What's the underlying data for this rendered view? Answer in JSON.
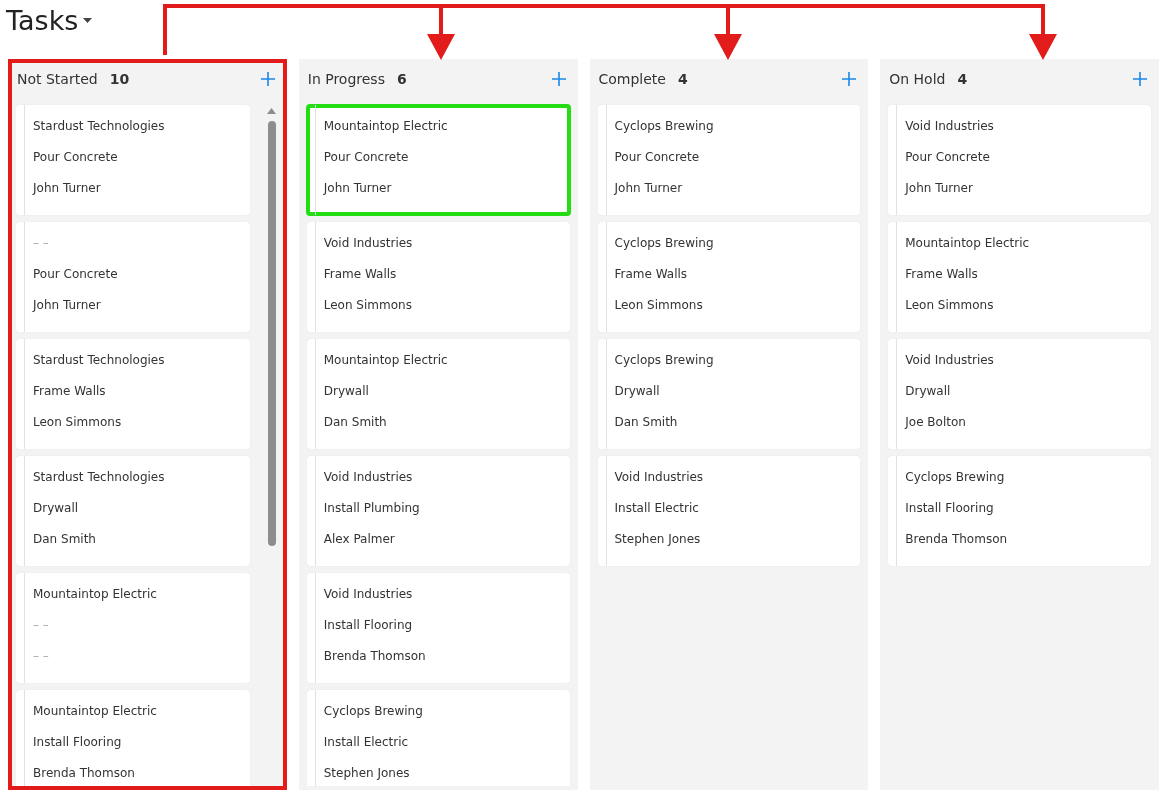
{
  "title": "Tasks",
  "columns": [
    {
      "name": "Not Started",
      "count": "10",
      "highlighted": true,
      "scrollable": true,
      "cards": [
        {
          "highlighted": false,
          "lines": [
            {
              "text": "Stardust Technologies",
              "muted": false
            },
            {
              "text": "Pour Concrete",
              "muted": false
            },
            {
              "text": "John Turner",
              "muted": false
            }
          ]
        },
        {
          "highlighted": false,
          "lines": [
            {
              "text": "– –",
              "muted": true
            },
            {
              "text": "Pour Concrete",
              "muted": false
            },
            {
              "text": "John Turner",
              "muted": false
            }
          ]
        },
        {
          "highlighted": false,
          "lines": [
            {
              "text": "Stardust Technologies",
              "muted": false
            },
            {
              "text": "Frame Walls",
              "muted": false
            },
            {
              "text": "Leon Simmons",
              "muted": false
            }
          ]
        },
        {
          "highlighted": false,
          "lines": [
            {
              "text": "Stardust Technologies",
              "muted": false
            },
            {
              "text": "Drywall",
              "muted": false
            },
            {
              "text": "Dan Smith",
              "muted": false
            }
          ]
        },
        {
          "highlighted": false,
          "lines": [
            {
              "text": "Mountaintop Electric",
              "muted": false
            },
            {
              "text": "– –",
              "muted": true
            },
            {
              "text": "– –",
              "muted": true
            }
          ]
        },
        {
          "highlighted": false,
          "lines": [
            {
              "text": "Mountaintop Electric",
              "muted": false
            },
            {
              "text": "Install Flooring",
              "muted": false
            },
            {
              "text": "Brenda Thomson",
              "muted": false
            }
          ]
        }
      ]
    },
    {
      "name": "In Progress",
      "count": "6",
      "highlighted": false,
      "scrollable": false,
      "cards": [
        {
          "highlighted": true,
          "lines": [
            {
              "text": "Mountaintop Electric",
              "muted": false
            },
            {
              "text": "Pour Concrete",
              "muted": false
            },
            {
              "text": "John Turner",
              "muted": false
            }
          ]
        },
        {
          "highlighted": false,
          "lines": [
            {
              "text": "Void Industries",
              "muted": false
            },
            {
              "text": "Frame Walls",
              "muted": false
            },
            {
              "text": "Leon Simmons",
              "muted": false
            }
          ]
        },
        {
          "highlighted": false,
          "lines": [
            {
              "text": "Mountaintop Electric",
              "muted": false
            },
            {
              "text": "Drywall",
              "muted": false
            },
            {
              "text": "Dan Smith",
              "muted": false
            }
          ]
        },
        {
          "highlighted": false,
          "lines": [
            {
              "text": "Void Industries",
              "muted": false
            },
            {
              "text": "Install Plumbing",
              "muted": false
            },
            {
              "text": "Alex Palmer",
              "muted": false
            }
          ]
        },
        {
          "highlighted": false,
          "lines": [
            {
              "text": "Void Industries",
              "muted": false
            },
            {
              "text": "Install Flooring",
              "muted": false
            },
            {
              "text": "Brenda Thomson",
              "muted": false
            }
          ]
        },
        {
          "highlighted": false,
          "lines": [
            {
              "text": "Cyclops Brewing",
              "muted": false
            },
            {
              "text": "Install Electric",
              "muted": false
            },
            {
              "text": "Stephen Jones",
              "muted": false
            }
          ]
        }
      ]
    },
    {
      "name": "Complete",
      "count": "4",
      "highlighted": false,
      "scrollable": false,
      "cards": [
        {
          "highlighted": false,
          "lines": [
            {
              "text": "Cyclops Brewing",
              "muted": false
            },
            {
              "text": "Pour Concrete",
              "muted": false
            },
            {
              "text": "John Turner",
              "muted": false
            }
          ]
        },
        {
          "highlighted": false,
          "lines": [
            {
              "text": "Cyclops Brewing",
              "muted": false
            },
            {
              "text": "Frame Walls",
              "muted": false
            },
            {
              "text": "Leon Simmons",
              "muted": false
            }
          ]
        },
        {
          "highlighted": false,
          "lines": [
            {
              "text": "Cyclops Brewing",
              "muted": false
            },
            {
              "text": "Drywall",
              "muted": false
            },
            {
              "text": "Dan Smith",
              "muted": false
            }
          ]
        },
        {
          "highlighted": false,
          "lines": [
            {
              "text": "Void Industries",
              "muted": false
            },
            {
              "text": "Install Electric",
              "muted": false
            },
            {
              "text": "Stephen Jones",
              "muted": false
            }
          ]
        }
      ]
    },
    {
      "name": "On Hold",
      "count": "4",
      "highlighted": false,
      "scrollable": false,
      "cards": [
        {
          "highlighted": false,
          "lines": [
            {
              "text": "Void Industries",
              "muted": false
            },
            {
              "text": "Pour Concrete",
              "muted": false
            },
            {
              "text": "John Turner",
              "muted": false
            }
          ]
        },
        {
          "highlighted": false,
          "lines": [
            {
              "text": "Mountaintop Electric",
              "muted": false
            },
            {
              "text": "Frame Walls",
              "muted": false
            },
            {
              "text": "Leon Simmons",
              "muted": false
            }
          ]
        },
        {
          "highlighted": false,
          "lines": [
            {
              "text": "Void Industries",
              "muted": false
            },
            {
              "text": "Drywall",
              "muted": false
            },
            {
              "text": "Joe Bolton",
              "muted": false
            }
          ]
        },
        {
          "highlighted": false,
          "lines": [
            {
              "text": "Cyclops Brewing",
              "muted": false
            },
            {
              "text": "Install Flooring",
              "muted": false
            },
            {
              "text": "Brenda Thomson",
              "muted": false
            }
          ]
        }
      ]
    }
  ]
}
